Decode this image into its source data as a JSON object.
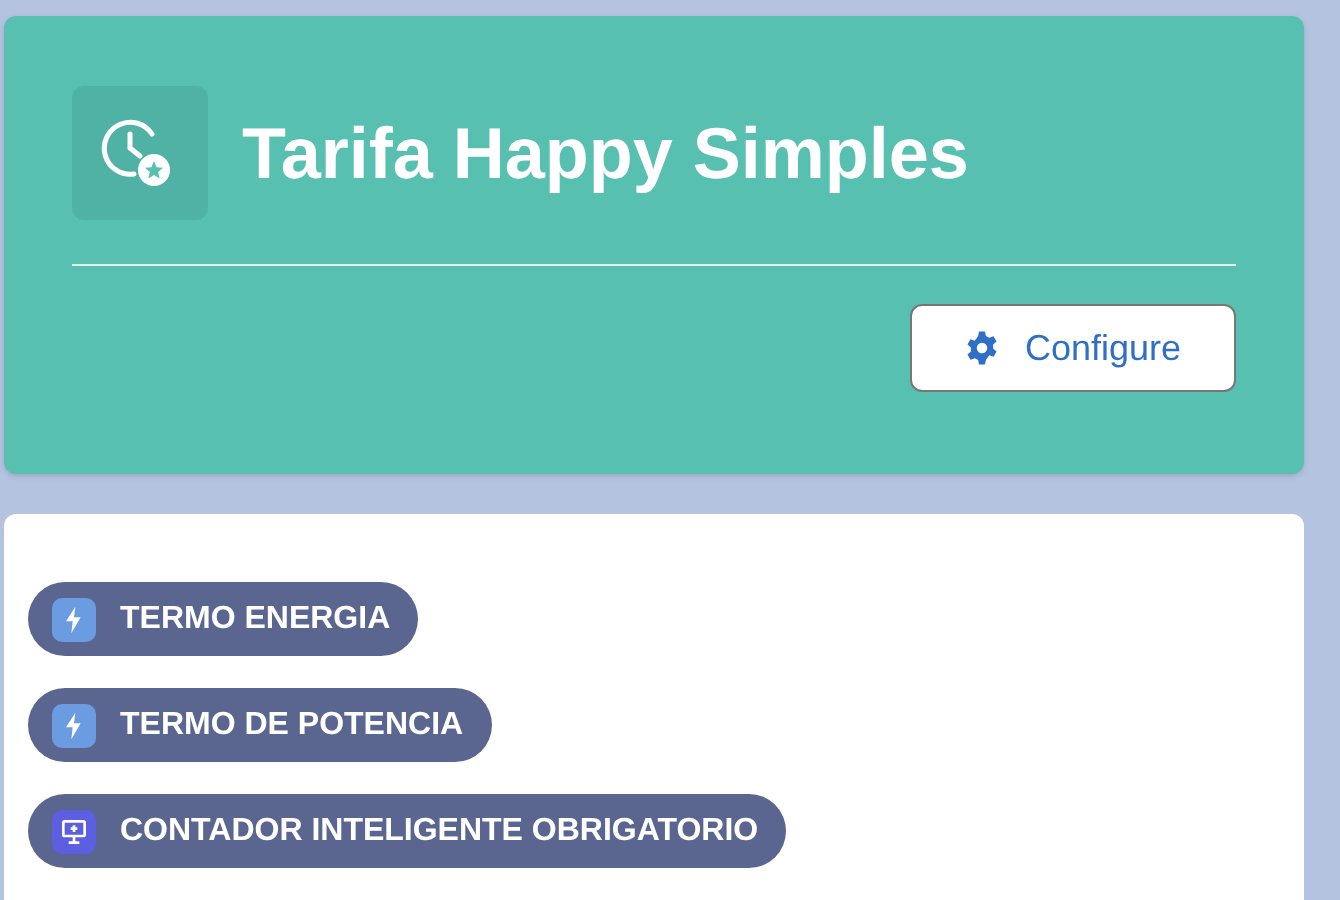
{
  "header": {
    "title": "Tarifa Happy Simples",
    "button": "Configure"
  },
  "tags": [
    {
      "label": "TERMO ENERGIA",
      "kind": "energy"
    },
    {
      "label": "TERMO DE POTENCIA",
      "kind": "energy"
    },
    {
      "label": "CONTADOR INTELIGENTE OBRIGATORIO",
      "kind": "monitor"
    }
  ]
}
